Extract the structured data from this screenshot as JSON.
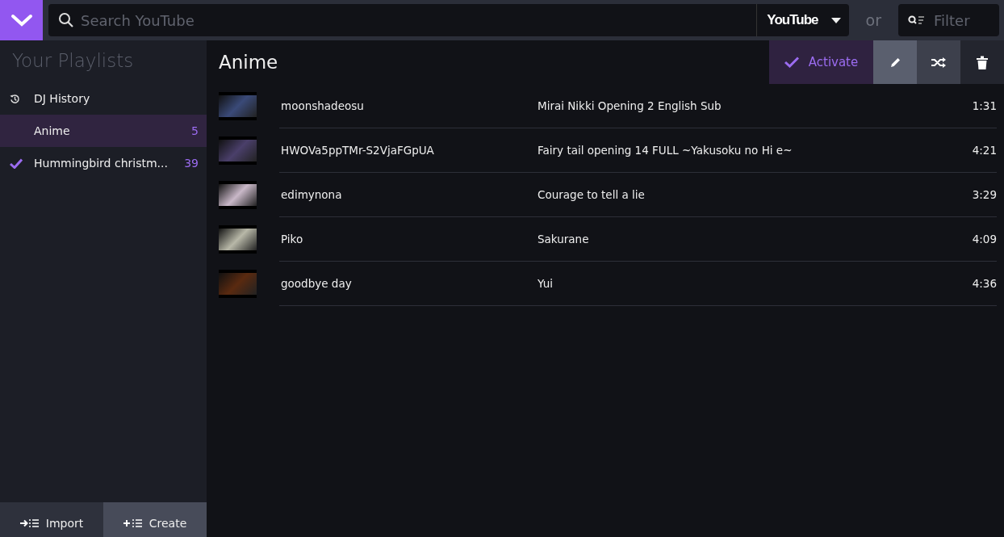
{
  "search": {
    "placeholder": "Search YouTube",
    "source": "YouTube"
  },
  "or_label": "or",
  "filter": {
    "placeholder": "Filter"
  },
  "sidebar": {
    "title": "Your Playlists",
    "items": [
      {
        "kind": "history",
        "name": "DJ History",
        "selected": false
      },
      {
        "kind": "playlist",
        "name": "Anime",
        "count": "5",
        "selected": true,
        "active": false
      },
      {
        "kind": "playlist",
        "name": "Hummingbird christm...",
        "count": "39",
        "selected": false,
        "active": true
      }
    ],
    "buttons": [
      {
        "kind": "import",
        "label": "Import"
      },
      {
        "kind": "create",
        "label": "Create"
      }
    ]
  },
  "playlist": {
    "title": "Anime",
    "activate_label": "Activate",
    "rows": [
      {
        "author": "moonshadeosu",
        "title": "Mirai Nikki Opening 2 English Sub",
        "duration": "1:31"
      },
      {
        "author": "HWOVa5ppTMr-S2VjaFGpUA",
        "title": "Fairy tail opening 14 FULL ~Yakusoku no Hi e~",
        "duration": "4:21"
      },
      {
        "author": "edimynona",
        "title": "Courage to tell a lie",
        "duration": "3:29"
      },
      {
        "author": "Piko",
        "title": "Sakurane",
        "duration": "4:09"
      },
      {
        "author": "goodbye day",
        "title": "Yui",
        "duration": "4:36"
      }
    ]
  }
}
